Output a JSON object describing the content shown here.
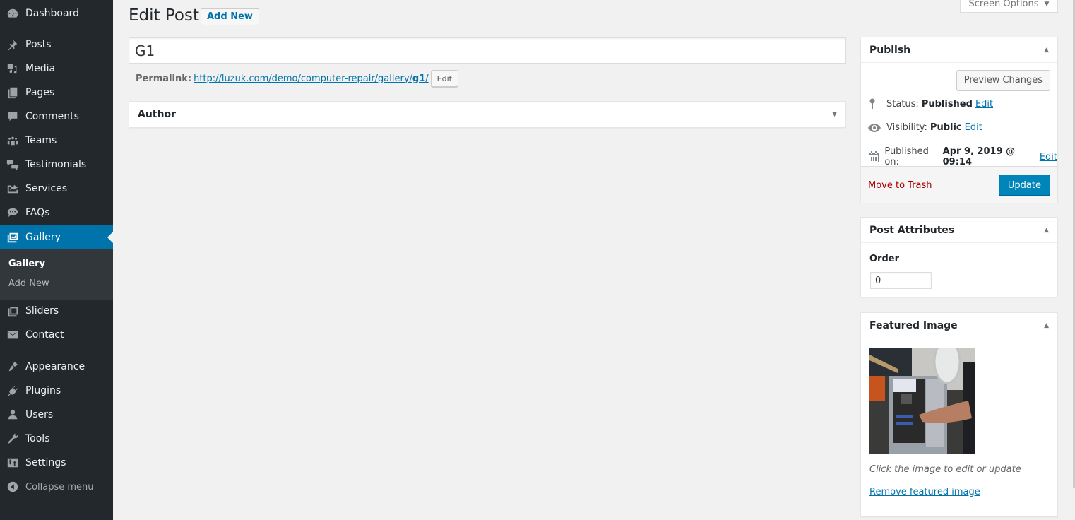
{
  "sidebar": {
    "items": [
      {
        "label": "Dashboard",
        "icon": "dashboard-icon"
      },
      {
        "label": "Posts",
        "icon": "pin-icon"
      },
      {
        "label": "Media",
        "icon": "media-icon"
      },
      {
        "label": "Pages",
        "icon": "pages-icon"
      },
      {
        "label": "Comments",
        "icon": "comment-icon"
      },
      {
        "label": "Teams",
        "icon": "groups-icon"
      },
      {
        "label": "Testimonials",
        "icon": "testimonial-icon"
      },
      {
        "label": "Services",
        "icon": "share-icon"
      },
      {
        "label": "FAQs",
        "icon": "chat-icon"
      },
      {
        "label": "Gallery",
        "icon": "gallery-icon"
      },
      {
        "label": "Sliders",
        "icon": "slides-icon"
      },
      {
        "label": "Contact",
        "icon": "mail-icon"
      },
      {
        "label": "Appearance",
        "icon": "brush-icon"
      },
      {
        "label": "Plugins",
        "icon": "plugin-icon"
      },
      {
        "label": "Users",
        "icon": "user-icon"
      },
      {
        "label": "Tools",
        "icon": "wrench-icon"
      },
      {
        "label": "Settings",
        "icon": "settings-icon"
      }
    ],
    "current": "Gallery",
    "submenu": [
      {
        "label": "Gallery",
        "active": true
      },
      {
        "label": "Add New",
        "active": false
      }
    ],
    "collapse_label": "Collapse menu"
  },
  "header": {
    "title": "Edit Post",
    "add_new_label": "Add New",
    "screen_options_label": "Screen Options"
  },
  "editor": {
    "title_value": "G1",
    "permalink_label": "Permalink:",
    "permalink_base": "http://luzuk.com/demo/computer-repair/gallery/",
    "permalink_slug": "g1",
    "permalink_trailing": "/",
    "permalink_edit_label": "Edit"
  },
  "author_box": {
    "title": "Author"
  },
  "publish_box": {
    "title": "Publish",
    "preview_label": "Preview Changes",
    "status_label": "Status:",
    "status_value": "Published",
    "visibility_label": "Visibility:",
    "visibility_value": "Public",
    "published_on_label": "Published on:",
    "published_on_value": "Apr 9, 2019 @ 09:14",
    "edit_label": "Edit",
    "trash_label": "Move to Trash",
    "update_label": "Update"
  },
  "attributes_box": {
    "title": "Post Attributes",
    "order_label": "Order",
    "order_value": "0"
  },
  "featured_box": {
    "title": "Featured Image",
    "hint": "Click the image to edit or update",
    "remove_label": "Remove featured image"
  },
  "colors": {
    "sidebar_bg": "#23282d",
    "accent": "#0073aa",
    "update_button": "#0085ba",
    "trash_link": "#aa0000"
  }
}
